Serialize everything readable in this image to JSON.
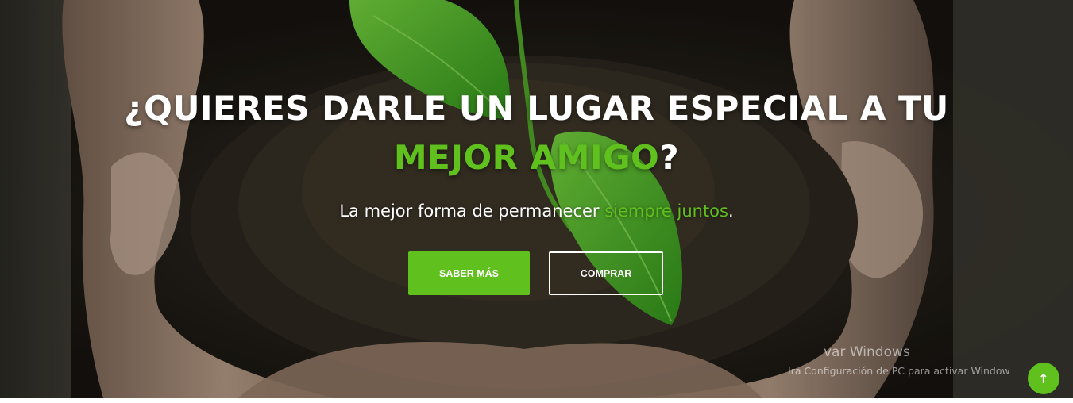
{
  "hero": {
    "headline_line1": "¿QUIERES DARLE UN LUGAR ESPECIAL A TU",
    "headline_accent": "MEJOR AMIGO",
    "headline_end": "?",
    "subtitle_start": "La mejor forma de permanecer ",
    "subtitle_accent": "siempre juntos",
    "subtitle_end": ".",
    "background_image": "hands-holding-soil-with-sprout"
  },
  "buttons": {
    "primary_label": "SABER MÁS",
    "secondary_label": "COMPRAR"
  },
  "watermark": {
    "title": "var Windows",
    "subtitle": "Ira Configuración de PC para activar Window"
  },
  "scroll_top": {
    "icon": "arrow-up-icon",
    "glyph": "↑"
  },
  "colors": {
    "accent": "#5fc01e",
    "text": "#ffffff"
  }
}
